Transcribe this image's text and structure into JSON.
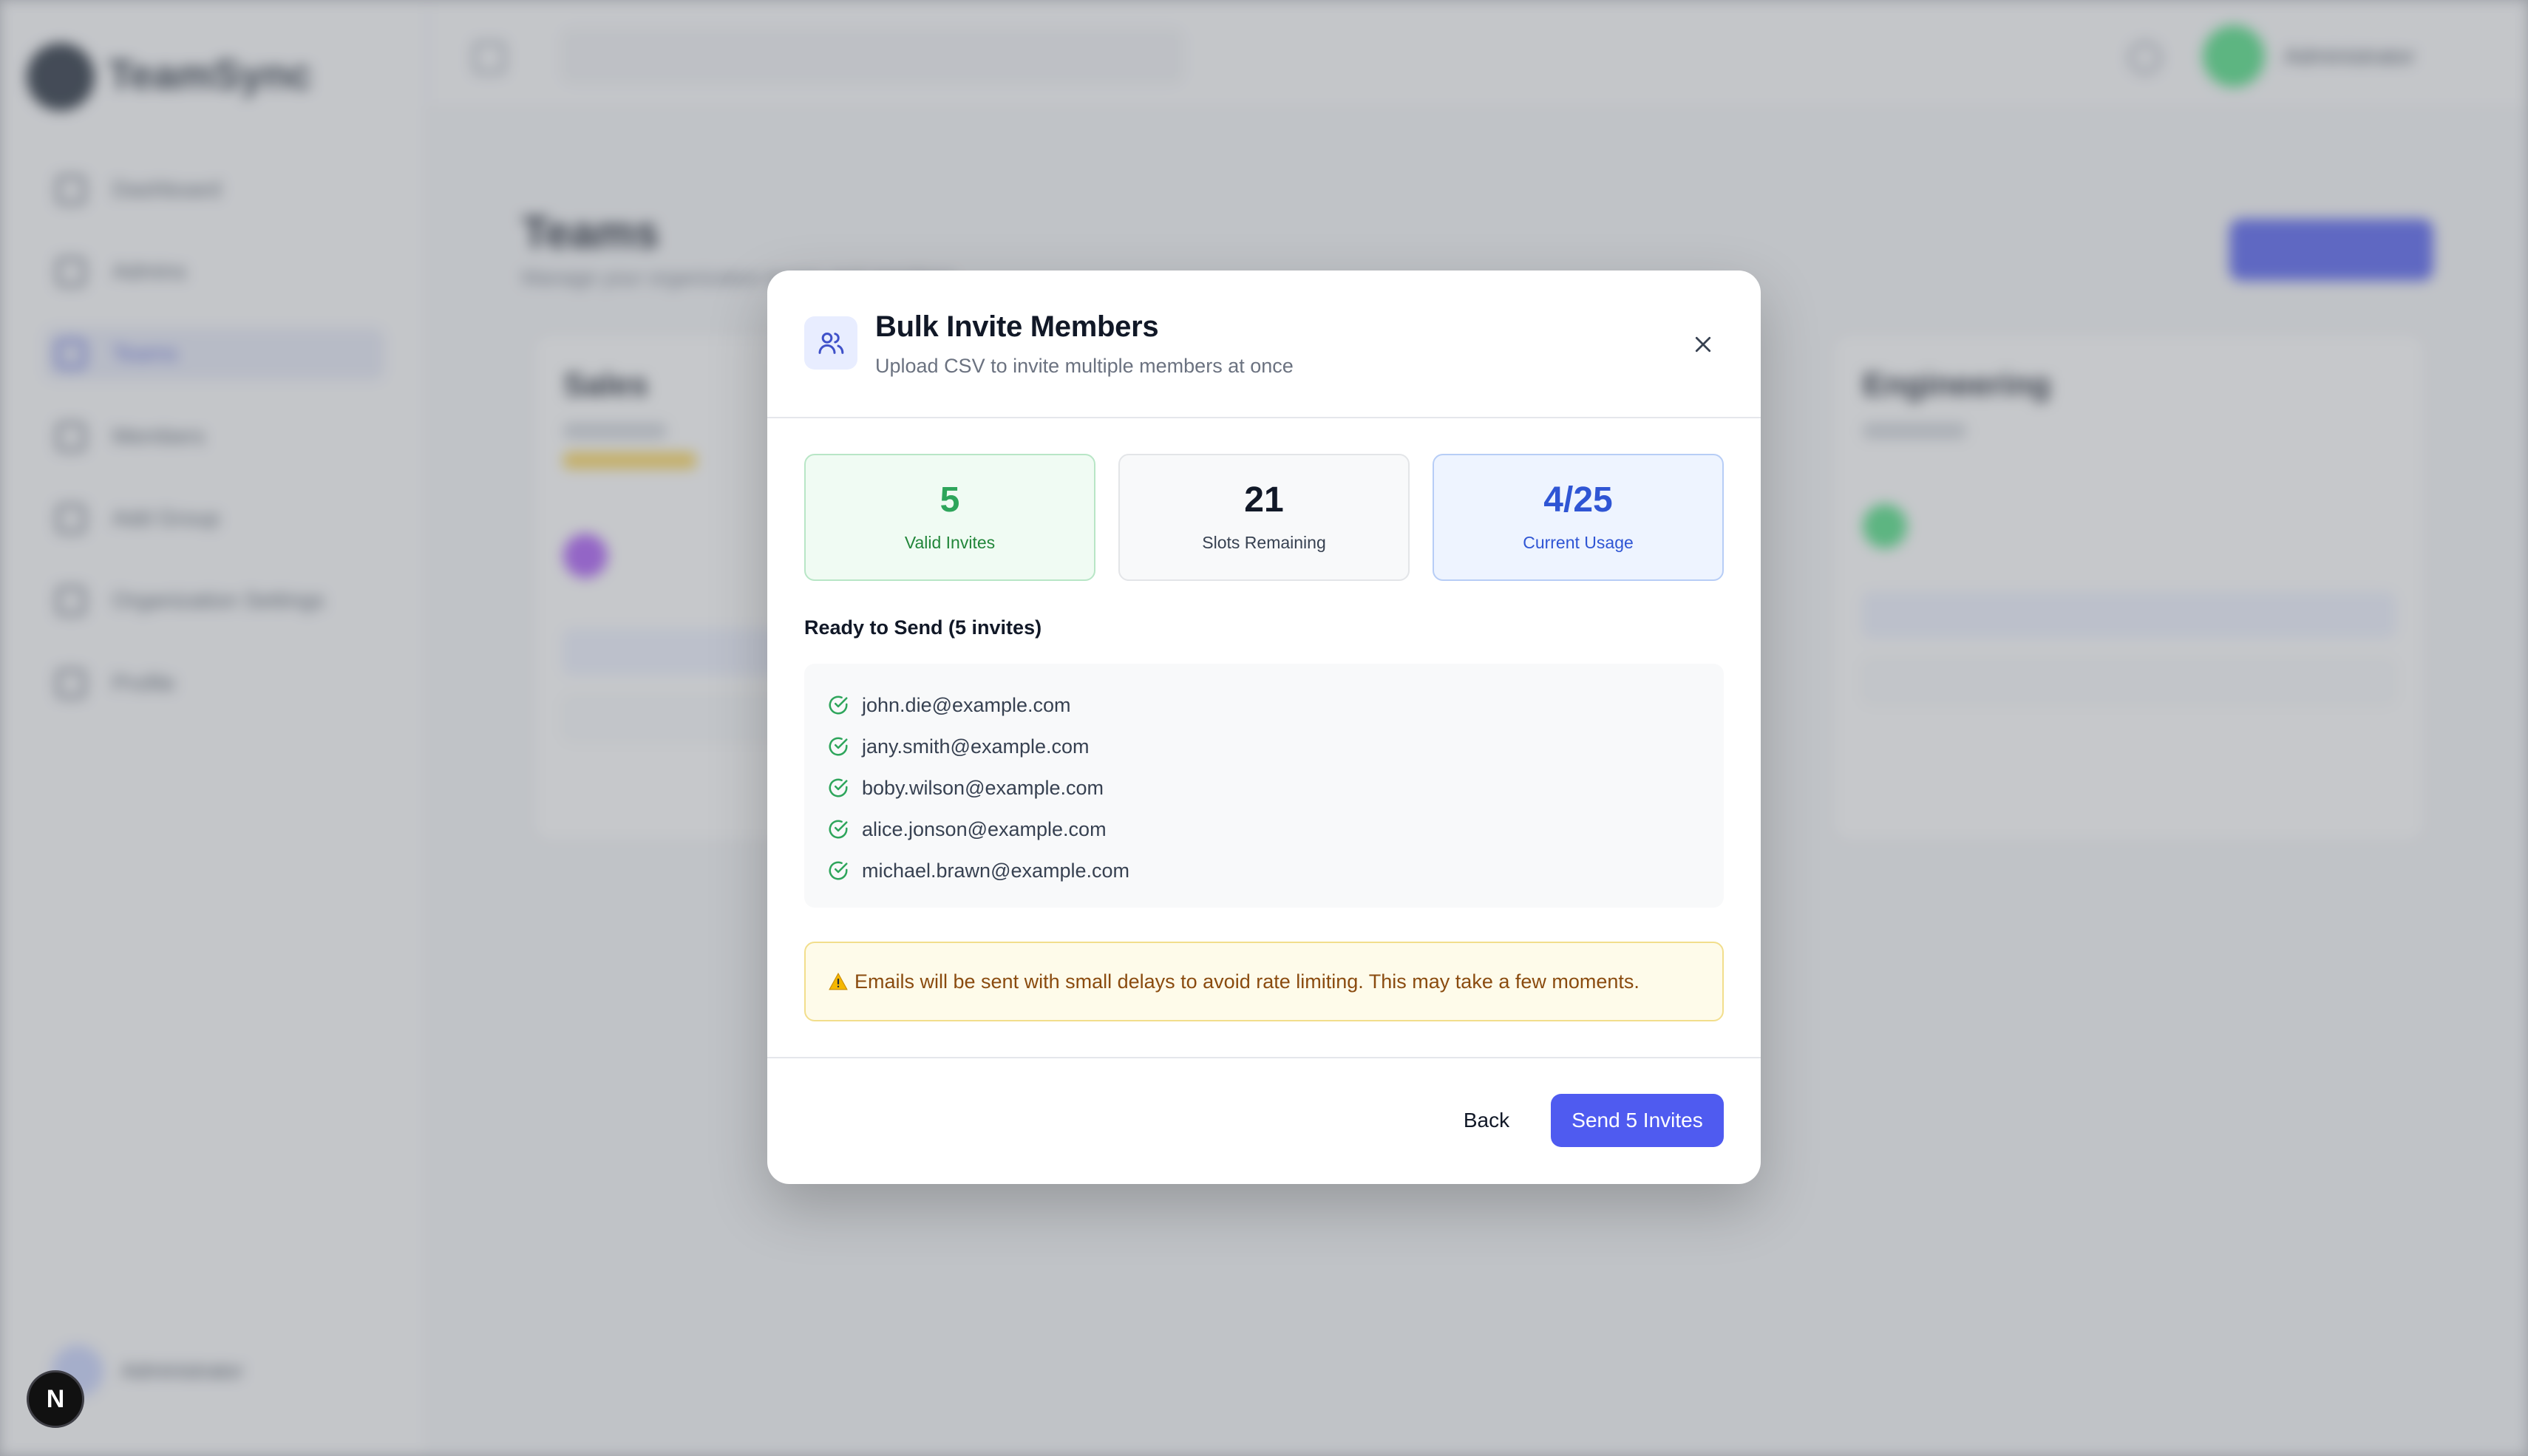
{
  "background": {
    "brand": "TeamSync",
    "nav_items": [
      "Dashboard",
      "Admins",
      "Teams",
      "Members",
      "Add Group",
      "Organization Settings",
      "Profile"
    ],
    "active_nav": "Teams",
    "page_title": "Teams",
    "page_subtitle": "Manage your organization teams and members",
    "create_button": "Create Team",
    "search_placeholder": "Search teams or members...",
    "user_name": "Administrator",
    "cards": [
      {
        "name": "Sales",
        "meta": "5 members"
      },
      {
        "name": "Engineering",
        "meta": "8 members"
      }
    ]
  },
  "modal": {
    "title": "Bulk Invite Members",
    "subtitle": "Upload CSV to invite multiple members at once",
    "stats": [
      {
        "value": "5",
        "label": "Valid Invites",
        "tone": "green"
      },
      {
        "value": "21",
        "label": "Slots Remaining",
        "tone": "gray"
      },
      {
        "value": "4/25",
        "label": "Current Usage",
        "tone": "blue"
      }
    ],
    "ready_label": "Ready to Send (5 invites)",
    "emails": [
      "john.die@example.com",
      "jany.smith@example.com",
      "boby.wilson@example.com",
      "alice.jonson@example.com",
      "michael.brawn@example.com"
    ],
    "warning": "Emails will be sent with small delays to avoid rate limiting. This may take a few moments.",
    "back_label": "Back",
    "send_label": "Send 5 Invites"
  },
  "colors": {
    "accent": "#4f5bf0",
    "success": "#2ea55b",
    "info": "#2f55d4",
    "warning_text": "#8a4b0f"
  },
  "next_badge": "N"
}
